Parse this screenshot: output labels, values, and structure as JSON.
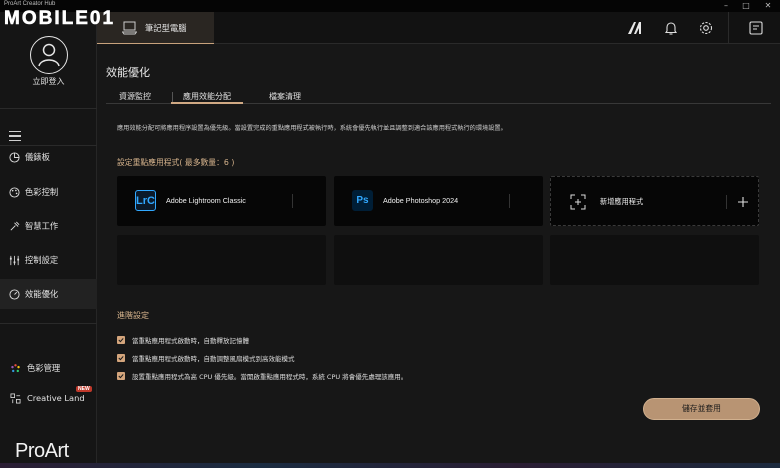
{
  "window": {
    "title": "ProArt Creator Hub",
    "watermark": "MOBILE01"
  },
  "sidebar": {
    "login_label": "立即登入",
    "items": [
      {
        "label": "儀錶板",
        "icon": "dashboard-icon"
      },
      {
        "label": "色彩控制",
        "icon": "palette-icon"
      },
      {
        "label": "智慧工作",
        "icon": "smart-work-icon"
      },
      {
        "label": "控制設定",
        "icon": "sliders-icon"
      },
      {
        "label": "效能優化",
        "icon": "performance-icon",
        "active": true
      }
    ],
    "color_management_label": "色彩管理",
    "creative_land_label": "Creative Land",
    "new_badge": "NEW",
    "brand": "ProArt"
  },
  "topbar": {
    "device_label": "筆記型電腦",
    "icons": [
      "proart-mark-icon",
      "bell-icon",
      "gear-icon",
      "feedback-icon"
    ]
  },
  "main": {
    "title": "效能優化",
    "tabs": [
      {
        "label": "資源監控",
        "active": false
      },
      {
        "label": "應用效能分配",
        "active": true
      },
      {
        "label": "檔案清理",
        "active": false
      }
    ],
    "description": "應用效能分配可將應用程序設置為優先級。當設置完成的重點應用程式被執行時，系統會優先執行並且調整到適合該應用程式執行的環境設置。",
    "section_title": "設定重點應用程式( 最多數量：6 )",
    "apps": [
      {
        "icon_text": "LrC",
        "name": "Adobe Lightroom Classic"
      },
      {
        "icon_text": "Ps",
        "name": "Adobe Photoshop 2024"
      }
    ],
    "add_app_label": "新增應用程式",
    "advanced_title": "進階設定",
    "options": [
      {
        "label": "當重點應用程式啟動時，自動釋放記憶體",
        "checked": true
      },
      {
        "label": "當重點應用程式啟動時，自動調整風扇模式到高效能模式",
        "checked": true
      },
      {
        "label": "設置重點應用程式為高 CPU 優先級。當開啟重點應用程式時，系統 CPU 將會優先處理該應用。",
        "checked": true
      }
    ],
    "save_label": "儲存並套用"
  },
  "colors": {
    "accent": "#d0a984",
    "background": "#171717",
    "sidebar": "#151515"
  }
}
